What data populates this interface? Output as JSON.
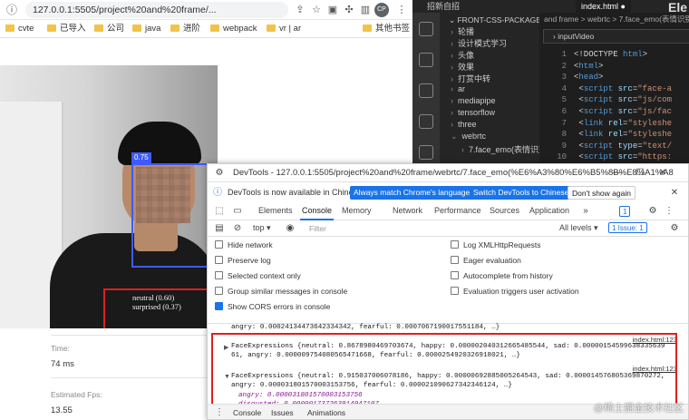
{
  "browser": {
    "url": "127.0.0.1:5505/project%20and%20frame/...",
    "bookmarks": [
      "cvte",
      "已导入",
      "公司",
      "java",
      "进阶",
      "webpack",
      "vr | ar",
      "其他书签"
    ]
  },
  "page": {
    "face_score": "0.75",
    "expressions": [
      "neutral (0.60)",
      "surprised (0.37)"
    ],
    "time_label": "Time:",
    "time_value": "74 ms",
    "fps_label": "Estimated Fps:",
    "fps_value": "13.55"
  },
  "vscode": {
    "tabs": [
      "招新自招",
      "index.html ●"
    ],
    "brand": "Ele",
    "explorer_title": "FRONT-CSS-PACKAGE",
    "explorer_items": [
      "轮播",
      "设计模式学习",
      "头像",
      "效果",
      "打赏中转",
      "ar",
      "mediapipe",
      "tensorflow",
      "three",
      "webrtc",
      "7.face_emo(表情识别)"
    ],
    "breadcrumb": "and frame > webrtc > 7.face_emo(表情识别",
    "find_value": "inputVideo",
    "code_lines": [
      {
        "num": "1",
        "parts": [
          {
            "c": "plain",
            "t": "<!DOCTYPE "
          },
          {
            "c": "tag",
            "t": "html"
          },
          {
            "c": "plain",
            "t": ">"
          }
        ]
      },
      {
        "num": "2",
        "parts": [
          {
            "c": "plain",
            "t": "<"
          },
          {
            "c": "tag",
            "t": "html"
          },
          {
            "c": "plain",
            "t": ">"
          }
        ]
      },
      {
        "num": "3",
        "parts": [
          {
            "c": "plain",
            "t": "<"
          },
          {
            "c": "tag",
            "t": "head"
          },
          {
            "c": "plain",
            "t": ">"
          }
        ]
      },
      {
        "num": "4",
        "parts": [
          {
            "c": "plain",
            "t": "  <"
          },
          {
            "c": "tag",
            "t": "script "
          },
          {
            "c": "attr",
            "t": "src"
          },
          {
            "c": "plain",
            "t": "="
          },
          {
            "c": "str",
            "t": "\"face-a"
          }
        ]
      },
      {
        "num": "5",
        "parts": [
          {
            "c": "plain",
            "t": "  <"
          },
          {
            "c": "tag",
            "t": "script "
          },
          {
            "c": "attr",
            "t": "src"
          },
          {
            "c": "plain",
            "t": "="
          },
          {
            "c": "str",
            "t": "\"js/com"
          }
        ]
      },
      {
        "num": "6",
        "parts": [
          {
            "c": "plain",
            "t": "  <"
          },
          {
            "c": "tag",
            "t": "script "
          },
          {
            "c": "attr",
            "t": "src"
          },
          {
            "c": "plain",
            "t": "="
          },
          {
            "c": "str",
            "t": "\"js/fac"
          }
        ]
      },
      {
        "num": "7",
        "parts": [
          {
            "c": "plain",
            "t": "  <"
          },
          {
            "c": "tag",
            "t": "link "
          },
          {
            "c": "attr",
            "t": "rel"
          },
          {
            "c": "plain",
            "t": "="
          },
          {
            "c": "str",
            "t": "\"styleshe"
          }
        ]
      },
      {
        "num": "8",
        "parts": [
          {
            "c": "plain",
            "t": "  <"
          },
          {
            "c": "tag",
            "t": "link "
          },
          {
            "c": "attr",
            "t": "rel"
          },
          {
            "c": "plain",
            "t": "="
          },
          {
            "c": "str",
            "t": "\"styleshe"
          }
        ]
      },
      {
        "num": "9",
        "parts": [
          {
            "c": "plain",
            "t": "  <"
          },
          {
            "c": "tag",
            "t": "script "
          },
          {
            "c": "attr",
            "t": "type"
          },
          {
            "c": "plain",
            "t": "="
          },
          {
            "c": "str",
            "t": "\"text/"
          }
        ]
      },
      {
        "num": "10",
        "parts": [
          {
            "c": "plain",
            "t": "  <"
          },
          {
            "c": "tag",
            "t": "script "
          },
          {
            "c": "attr",
            "t": "src"
          },
          {
            "c": "plain",
            "t": "="
          },
          {
            "c": "str",
            "t": "\"https:"
          }
        ]
      }
    ]
  },
  "devtools": {
    "title": "DevTools - 127.0.0.1:5505/project%20and%20frame/webrtc/7.face_emo(%E6%A3%80%E6%B5%8B%E8%A1%A8",
    "banner_text": "DevTools is now available in Chinese!",
    "banner_btn_1": "Always match Chrome's language",
    "banner_btn_2": "Switch DevTools to Chinese",
    "banner_btn_3": "Don't show again",
    "tabs": [
      "Elements",
      "Console",
      "Memory",
      "Network",
      "Performance",
      "Sources",
      "Application"
    ],
    "error_count": "1",
    "context": "top ▾",
    "filter_placeholder": "Filter",
    "levels": "All levels ▾",
    "issues": "1 Issue: 1",
    "options_left": [
      "Hide network",
      "Preserve log",
      "Selected context only",
      "Group similar messages in console",
      "Show CORS errors in console"
    ],
    "options_right": [
      "Log XMLHttpRequests",
      "Eager evaluation",
      "Autocomplete from history",
      "Evaluation triggers user activation"
    ],
    "cut_line": "angry: 0.0002413447364233434​2, fearful: 0.000706719001755118​4, …}",
    "log1_source": "index.html:123",
    "log1_line1": "FaceExpressions {neutral: 0.8678980469703674, happy: 0.0000020403126654855​44, sad: 0.00000154599638335639",
    "log1_line2": "61, angry: 0.000009754080565471668, fearful: 0.0000254920326918021, …}",
    "log2_source": "index.html:123",
    "log2_line1": "FaceExpressions {neutral: 0.9150370060781​86, happy: 0.000006928850052645​43, sad: 0.0000145768053698702​72,",
    "log2_line2": "angry: 0.000031801570003153756, fearful: 0.000021090627342346124, …}",
    "log2_angry": "angry: 0.000031801570003153756",
    "log2_disgusted": "disgusted: 0.000001737263914947107",
    "drawer_tabs": [
      "Console",
      "Issues",
      "Animations"
    ]
  },
  "watermark": "@稀土掘金技术社区"
}
